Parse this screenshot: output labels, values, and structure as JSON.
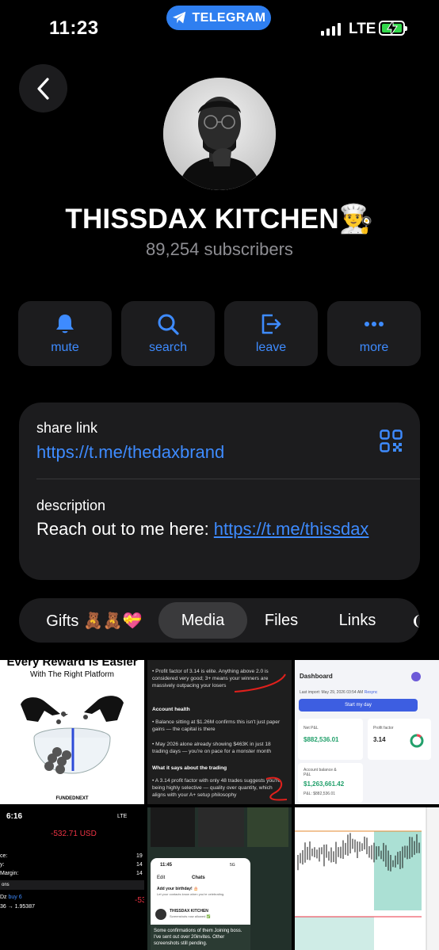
{
  "status_bar": {
    "time": "11:23",
    "app_pill": "TELEGRAM",
    "network": "LTE",
    "battery_level": 1.0
  },
  "header": {
    "back_icon": "chevron-left-icon"
  },
  "channel": {
    "name": "THISSDAX KITCHEN",
    "emoji": "👨‍🍳",
    "subscribers": "89,254 subscribers"
  },
  "actions": [
    {
      "label": "mute",
      "icon": "bell-icon"
    },
    {
      "label": "search",
      "icon": "search-icon"
    },
    {
      "label": "leave",
      "icon": "leave-icon"
    },
    {
      "label": "more",
      "icon": "more-icon"
    }
  ],
  "info": {
    "share_label": "share link",
    "share_url": "https://t.me/thedaxbrand",
    "description_label": "description",
    "description_text": "Reach out to me here: ",
    "description_link": "https://t.me/thissdax"
  },
  "tabs": [
    {
      "label": "Gifts 🧸🧸💝",
      "active": false
    },
    {
      "label": "Media",
      "active": true
    },
    {
      "label": "Files",
      "active": false
    },
    {
      "label": "Links",
      "active": false
    }
  ],
  "media": [
    {
      "caption_title": "Every Reward Is Easier",
      "caption_subtitle": "With The Right Platform",
      "brand": "FUNDEDNEXT"
    },
    {
      "lines": [
        "Profit factor of 3.14 is elite. Anything above 2.0 is considered very good; 3+ means your winners are massively outpacing your losers",
        "Account health",
        "Balance sitting at $1.26M confirms this isn't just paper gains — the capital is there",
        "May 2026 alone already showing $463K in just 18 trading days — you're on pace for a monster month",
        "What it says about the trading",
        "A 3.14 profit factor with only 48 trades suggests you're being highly selective — quality over quantity, which aligns with your A+ setup philosophy"
      ]
    },
    {
      "title": "Dashboard",
      "last_import": "Last import: May 29, 2026 03:54 AM",
      "resync": "Resync",
      "start_button": "Start my day",
      "net_pnl_label": "Net P&L",
      "net_pnl_value": "$882,536.01",
      "profit_factor_label": "Profit factor",
      "profit_factor_value": "3.14",
      "balance_label": "Account balance & P&L",
      "balance_value": "$1,263,661.42",
      "pnl_label": "P&L:",
      "pnl_value": "$882,536.01"
    },
    {
      "time": "6:16",
      "network": "LTE",
      "amount": "-532.71 USD",
      "rows": [
        {
          "label": "ce:",
          "value": "19"
        },
        {
          "label": "y:",
          "value": "14"
        },
        {
          "label": "Margin:",
          "value": "14"
        }
      ],
      "section": "ons",
      "trade_symbol": "Dz",
      "trade_side": "buy 6",
      "trade_prices": "36 → 1.95387",
      "trade_pl": "-53"
    },
    {
      "time": "11:45",
      "network": "5G",
      "edit": "Edit",
      "chats": "Chats",
      "birthday_title": "Add your birthday! 🎂",
      "birthday_text": "Let your contacts know when you're celebrating.",
      "chat_name": "THISSDAX KITCHEN",
      "chat_preview": "Screenshots now allowed ✅",
      "message": "Some confirmations of them Joining boss. I've sent out over 20invites. Other screenshots still pending."
    },
    {
      "chart": "price-chart"
    }
  ],
  "colors": {
    "accent": "#3e8bff",
    "card": "#1c1c1e",
    "pill": "#2f7ff0",
    "battery": "#32d74b",
    "pnl_green": "#22a06b"
  }
}
